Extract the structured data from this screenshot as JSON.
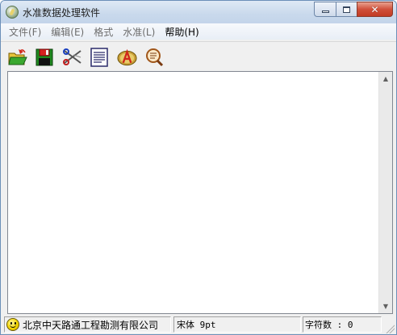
{
  "window": {
    "title": "水准数据处理软件",
    "controls": {
      "minimize": "minimize",
      "maximize": "maximize",
      "close": "✕"
    }
  },
  "menu": {
    "items": [
      {
        "label": "文件(F)",
        "enabled": false
      },
      {
        "label": "编辑(E)",
        "enabled": false
      },
      {
        "label": "格式",
        "enabled": false
      },
      {
        "label": "水准(L)",
        "enabled": false
      },
      {
        "label": "帮助(H)",
        "enabled": true
      }
    ]
  },
  "toolbar": {
    "buttons": [
      {
        "icon": "open-folder-icon"
      },
      {
        "icon": "save-disk-icon"
      },
      {
        "icon": "scissors-cut-icon"
      },
      {
        "icon": "document-list-icon"
      },
      {
        "icon": "font-a-icon"
      },
      {
        "icon": "magnifier-document-icon"
      }
    ]
  },
  "editor": {
    "content": ""
  },
  "status": {
    "company": "北京中天路通工程勘测有限公司",
    "font": "宋体 9pt",
    "char_count": "字符数 : 0"
  },
  "colors": {
    "title_bar": "#c9d9ec",
    "close_button": "#c23b24",
    "menu_disabled_text": "#6d6d6d",
    "editor_background": "#ffffff"
  }
}
